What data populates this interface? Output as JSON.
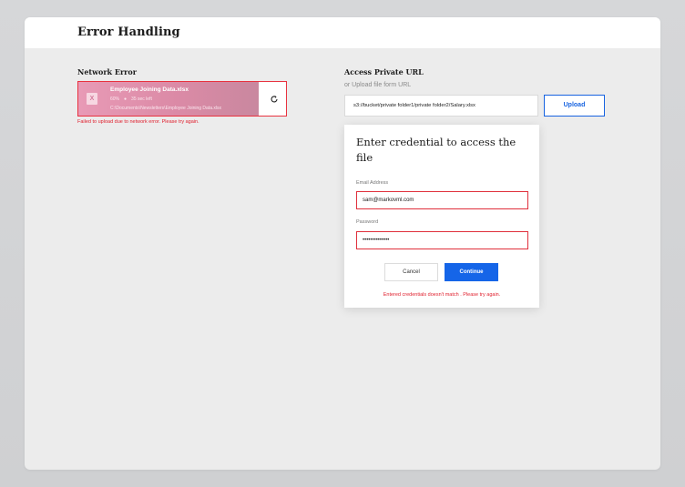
{
  "page": {
    "title": "Error Handling"
  },
  "network_error": {
    "label": "Network Error",
    "file_name": "Employee Joining Data.xlsx",
    "progress": "60%",
    "progress_fraction": 0.87,
    "time_left": "35 sec left",
    "file_path": "C:\\Documents\\Newsletters\\Employee Joining Data.xlsx",
    "file_icon": "excel-file-icon",
    "retry_icon": "retry-icon",
    "error_message": "Failed to upload due to network error. Please try again."
  },
  "private_url": {
    "label": "Access Private URL",
    "subtext": "or Upload file form URL",
    "url_value": "s3://bucket/private folder1/private folder2/Salary.xlsx",
    "upload_label": "Upload"
  },
  "credential_modal": {
    "title": "Enter credential to access the file",
    "email_label": "Email Address",
    "email_value": "sam@markovml.com",
    "password_label": "Password",
    "password_value": "••••••••••••••",
    "cancel_label": "Cancel",
    "continue_label": "Continue",
    "error_message": "Entered credentials doesn't match . Please try again."
  },
  "colors": {
    "accent": "#1565e8",
    "error": "#e0202e",
    "progress": "#e89ab6"
  }
}
